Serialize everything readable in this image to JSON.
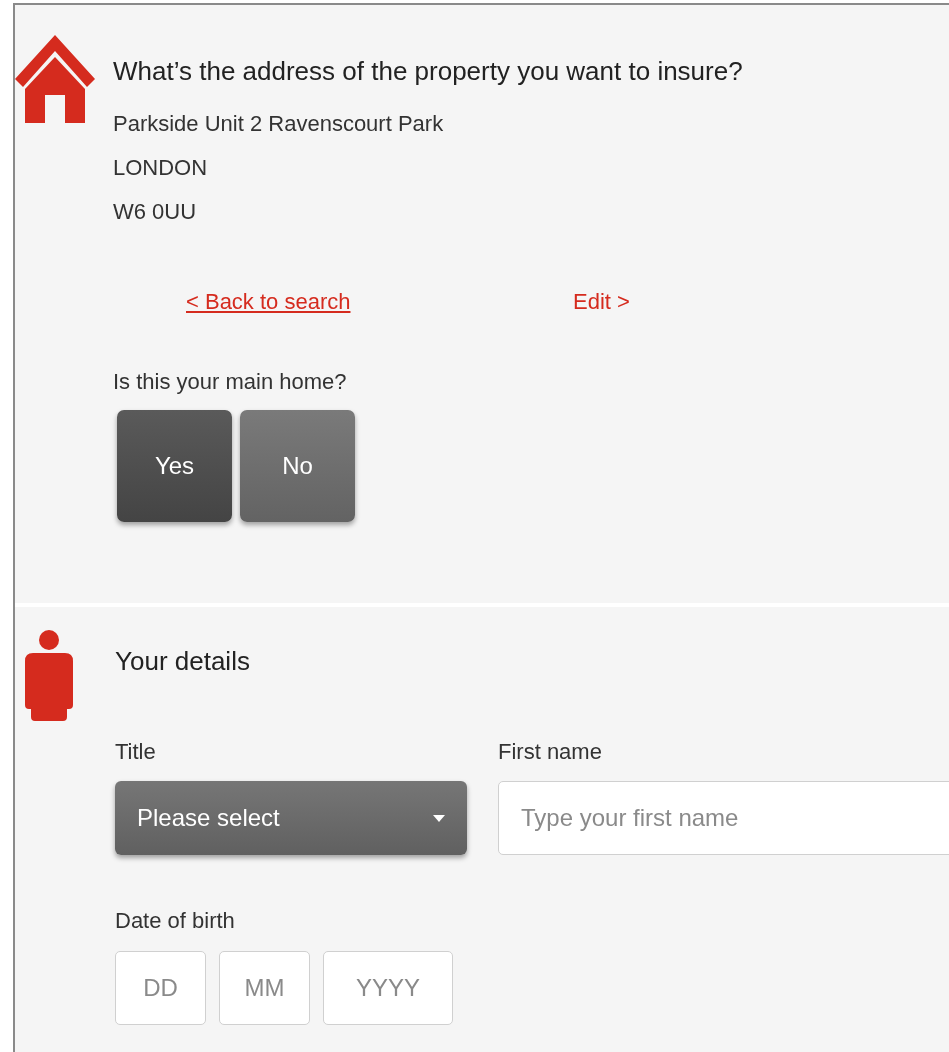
{
  "property": {
    "heading": "What’s the address of the property you want to insure?",
    "address_lines": [
      "Parkside Unit 2 Ravenscourt Park",
      "LONDON",
      "W6 0UU"
    ],
    "links": [
      {
        "label": "< Back to search",
        "underlined": true
      },
      {
        "label": "Edit >",
        "underlined": false
      }
    ],
    "main_home": {
      "question": "Is this your main home?",
      "options": [
        {
          "label": "Yes",
          "selected": true
        },
        {
          "label": "No",
          "selected": false
        }
      ]
    }
  },
  "details": {
    "heading": "Your details",
    "title": {
      "label": "Title",
      "value": "Please select"
    },
    "first_name": {
      "label": "First name",
      "placeholder": "Type your first name"
    },
    "date_of_birth": {
      "label": "Date of birth",
      "fields": [
        {
          "placeholder": "DD"
        },
        {
          "placeholder": "MM"
        },
        {
          "placeholder": "YYYY"
        }
      ]
    }
  }
}
